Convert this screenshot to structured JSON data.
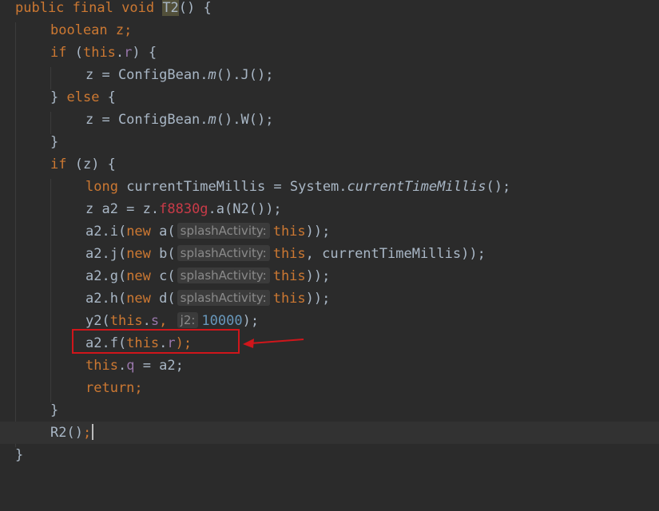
{
  "method": {
    "kw_public": "public",
    "kw_final": "final",
    "kw_void": "void",
    "name": "T2",
    "sig_rest": "() {"
  },
  "lines": {
    "l2": {
      "kw": "boolean",
      "rest": " z;"
    },
    "l3": {
      "kw_if": "if",
      "open": " (",
      "this": "this",
      "dot": ".",
      "field": "r",
      "close": ") {"
    },
    "l4": {
      "pre": "z = ConfigBean.",
      "m": "m",
      "post": "().J();"
    },
    "l5": {
      "close": "} ",
      "kw": "else",
      "open": " {"
    },
    "l6": {
      "pre": "z = ConfigBean.",
      "m": "m",
      "post": "().W();"
    },
    "l7": {
      "text": "}"
    },
    "l8": {
      "kw_if": "if",
      "rest": " (z) {"
    },
    "l9": {
      "kw": "long",
      "pre": " currentTimeMillis = System.",
      "m": "currentTimeMillis",
      "post": "();"
    },
    "l10": {
      "pre": "z a2 = z.",
      "field": "f8830g",
      "post": ".a(N2());"
    },
    "l11": {
      "pre": "a2.i(",
      "kw_new": "new",
      "call": " a(",
      "hint": "splashActivity:",
      "this": "this",
      "post": "));"
    },
    "l12": {
      "pre": "a2.j(",
      "kw_new": "new",
      "call": " b(",
      "hint": "splashActivity:",
      "this": "this",
      "post": ", currentTimeMillis));"
    },
    "l13": {
      "pre": "a2.g(",
      "kw_new": "new",
      "call": " c(",
      "hint": "splashActivity:",
      "this": "this",
      "post": "));"
    },
    "l14": {
      "pre": "a2.h(",
      "kw_new": "new",
      "call": " d(",
      "hint": "splashActivity:",
      "this": "this",
      "post": "));"
    },
    "l15": {
      "pre": "y2(",
      "this": "this",
      "dot": ".",
      "field": "s",
      "comma": ", ",
      "hint": "j2:",
      "num": "10000",
      "post": ");"
    },
    "l16": {
      "pre": "a2.f(",
      "this": "this",
      "dot": ".",
      "field": "r",
      "post": ");"
    },
    "l17": {
      "this": "this",
      "dot": ".",
      "field": "q",
      "post": " = a2;"
    },
    "l18": {
      "kw": "return",
      "post": ";"
    },
    "l19": {
      "text": "}"
    },
    "l20": {
      "pre": "R2()",
      "post": ";"
    },
    "l21": {
      "text": "}"
    }
  },
  "colors": {
    "background": "#2b2b2b",
    "keyword": "#cc7832",
    "field": "#9876aa",
    "number": "#6897bb",
    "annotation_box": "#d0161b"
  }
}
